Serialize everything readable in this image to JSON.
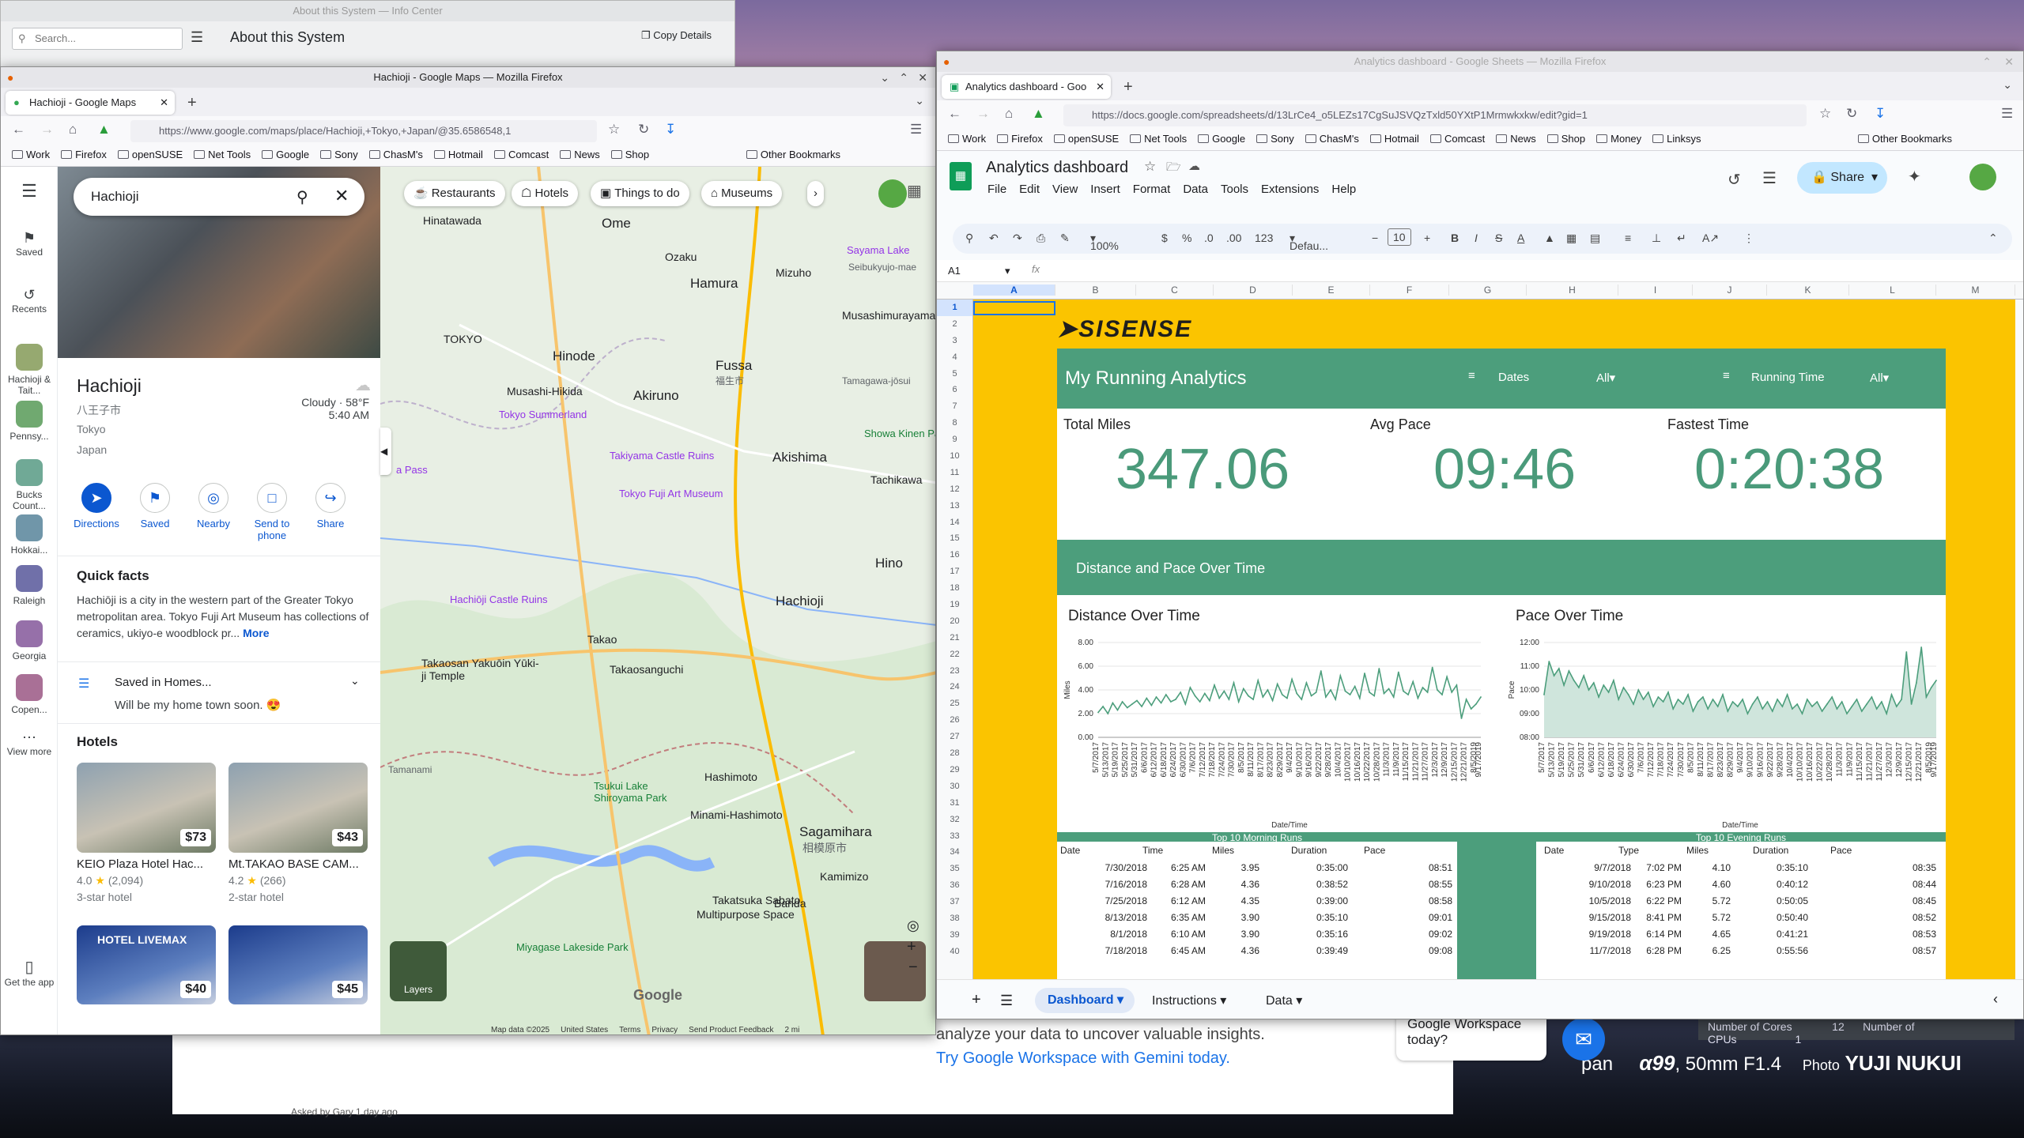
{
  "desktop": {
    "photo_credit_model": "α99",
    "photo_credit_lens": ", 50mm F1.4",
    "photo_credit_prefix": "Photo",
    "photo_credit_name": "YUJI NUKUI",
    "photo_credit_partial": "pan"
  },
  "info_center": {
    "title": "About this System — Info Center",
    "search_placeholder": "Search...",
    "heading": "About this System",
    "copy_button": "Copy Details"
  },
  "background_page": {
    "line1": "analyze your data to uncover valuable insights.",
    "line2": "Try Google Workspace with Gemini today.",
    "bubble": "Google Workspace today?",
    "sys_cores_label": "Number of Cores",
    "sys_cores_value": "12",
    "sys_cpus_label": "Number of CPUs",
    "sys_cpus_value": "1",
    "asked": "Asked by Gary 1 day ago"
  },
  "maps_window": {
    "title": "Hachioji - Google Maps — Mozilla Firefox",
    "tab_title": "Hachioji - Google Maps",
    "url": "https://www.google.com/maps/place/Hachioji,+Tokyo,+Japan/@35.6586548,1",
    "bookmarks": [
      "Work",
      "Firefox",
      "openSUSE",
      "Net Tools",
      "Google",
      "Sony",
      "ChasM's",
      "Hotmail",
      "Comcast",
      "News",
      "Shop"
    ],
    "other_bookmarks": "Other Bookmarks"
  },
  "maps": {
    "search_value": "Hachioji",
    "rail": [
      {
        "label": "Saved"
      },
      {
        "label": "Recents"
      },
      {
        "label": "Hachioji & Tait..."
      },
      {
        "label": "Pennsy..."
      },
      {
        "label": "Bucks Count..."
      },
      {
        "label": "Hokkai..."
      },
      {
        "label": "Raleigh"
      },
      {
        "label": "Georgia"
      },
      {
        "label": "Copen..."
      },
      {
        "label": "View more"
      }
    ],
    "get_app": "Get the app",
    "place": {
      "name": "Hachioji",
      "native": "八王子市",
      "region": "Tokyo",
      "country": "Japan",
      "weather": "Cloudy · 58°F",
      "time": "5:40 AM"
    },
    "actions": [
      "Directions",
      "Saved",
      "Nearby",
      "Send to phone",
      "Share"
    ],
    "quick_facts_title": "Quick facts",
    "quick_facts_text": "Hachiōji is a city in the western part of the Greater Tokyo metropolitan area. Tokyo Fuji Art Museum has collections of ceramics, ukiyo-e woodblock pr...",
    "more_link": "More",
    "saved_in": "Saved in Homes...",
    "saved_note": "Will be my home town soon. 😍",
    "hotels_title": "Hotels",
    "hotels": [
      {
        "price": "$73",
        "name": "KEIO Plaza Hotel Hac...",
        "rating": "4.0",
        "reviews": "(2,094)",
        "class": "3-star hotel"
      },
      {
        "price": "$43",
        "name": "Mt.TAKAO BASE CAM...",
        "rating": "4.2",
        "reviews": "(266)",
        "class": "2-star hotel"
      },
      {
        "price": "$40",
        "name": "HOTEL LIVEMAX"
      },
      {
        "price": "$45",
        "name": ""
      }
    ],
    "chips": [
      "Restaurants",
      "Hotels",
      "Things to do",
      "Museums"
    ],
    "labels": {
      "ome": "Ome",
      "tokyo": "TOKYO",
      "hinode": "Hinode",
      "hamura": "Hamura",
      "fussa": "Fussa",
      "fussa_jp": "福生市",
      "mizuho": "Mizuho",
      "musashimurayama": "Musashimurayama",
      "akiruno": "Akiruno",
      "musashi_hikida": "Musashi-Hikida",
      "akishima": "Akishima",
      "hino": "Hino",
      "hachioji": "Hachioji",
      "takao": "Takao",
      "takaosanguchi": "Takaosanguchi",
      "hashimoto": "Hashimoto",
      "minami_hashimoto": "Minami-Hashimoto",
      "sagamihara": "Sagamihara",
      "sagamihara_jp": "相模原市",
      "kamimizo": "Kamimizo",
      "tachikawa": "Tachikawa",
      "banda": "Banda",
      "hinatawada": "Hinatawada",
      "ozaku": "Ozaku",
      "tamagawa_josui": "Tamagawa-jōsui",
      "sayama_lake": "Sayama Lake",
      "seibukyujo": "Seibukyujo-mae",
      "tokyo_summerland": "Tokyo Summerland",
      "takiyama": "Takiyama Castle Ruins",
      "fuji_museum": "Tokyo Fuji Art Museum",
      "castle_ruins": "Hachiōji Castle Ruins",
      "takaosan_yakuoin": "Takaosan Yakuōin Yūki-ji Temple",
      "tsukui": "Tsukui Lake Shiroyama Park",
      "miyagase": "Miyagase Lakeside Park",
      "showa": "Showa Kinen Park",
      "takatsuka": "Multipurpose Space",
      "takatsuka_title": "Takatsuka Sabato",
      "tamanami": "Tamanami",
      "pass": "a Pass"
    },
    "layers": "Layers",
    "footer": [
      "Map data ©2025",
      "United States",
      "Terms",
      "Privacy",
      "Send Product Feedback",
      "2 mi"
    ]
  },
  "sheets_window": {
    "title": "Analytics dashboard - Google Sheets — Mozilla Firefox",
    "tab_title": "Analytics dashboard - Goo",
    "url": "https://docs.google.com/spreadsheets/d/13LrCe4_o5LEZs17CgSuJSVQzTxld50YXtP1Mrmwkxkw/edit?gid=1",
    "bookmarks": [
      "Work",
      "Firefox",
      "openSUSE",
      "Net Tools",
      "Google",
      "Sony",
      "ChasM's",
      "Hotmail",
      "Comcast",
      "News",
      "Shop",
      "Money",
      "Linksys"
    ],
    "other_bookmarks": "Other Bookmarks"
  },
  "sheets": {
    "doc_title": "Analytics dashboard",
    "menu": [
      "File",
      "Edit",
      "View",
      "Insert",
      "Format",
      "Data",
      "Tools",
      "Extensions",
      "Help"
    ],
    "share": "Share",
    "zoom": "100%",
    "font": "Defau...",
    "font_size": "10",
    "cell_ref": "A1",
    "columns": [
      "A",
      "B",
      "C",
      "D",
      "E",
      "F",
      "G",
      "H",
      "I",
      "J",
      "K",
      "L",
      "M"
    ],
    "tabs": [
      "Dashboard",
      "Instructions",
      "Data"
    ]
  },
  "dashboard": {
    "logo": "SISENSE",
    "title": "My Running Analytics",
    "filter1_label": "Dates",
    "filter1_value": "All",
    "filter2_label": "Running Time",
    "filter2_value": "All",
    "kpis": [
      {
        "label": "Total Miles",
        "value": "347.06"
      },
      {
        "label": "Avg Pace",
        "value": "09:46"
      },
      {
        "label": "Fastest Time",
        "value": "0:20:38"
      }
    ],
    "section_title": "Distance and Pace Over Time",
    "morning_title": "Top 10 Morning Runs",
    "morning_headers": [
      "Date",
      "Time",
      "Miles",
      "Duration",
      "Pace"
    ],
    "morning_rows": [
      [
        "7/30/2018",
        "6:25 AM",
        "3.95",
        "0:35:00",
        "08:51"
      ],
      [
        "7/16/2018",
        "6:28 AM",
        "4.36",
        "0:38:52",
        "08:55"
      ],
      [
        "7/25/2018",
        "6:12 AM",
        "4.35",
        "0:39:00",
        "08:58"
      ],
      [
        "8/13/2018",
        "6:35 AM",
        "3.90",
        "0:35:10",
        "09:01"
      ],
      [
        "8/1/2018",
        "6:10 AM",
        "3.90",
        "0:35:16",
        "09:02"
      ],
      [
        "7/18/2018",
        "6:45 AM",
        "4.36",
        "0:39:49",
        "09:08"
      ]
    ],
    "evening_title": "Top 10 Evening Runs",
    "evening_headers": [
      "Date",
      "Type",
      "Miles",
      "Duration",
      "Pace"
    ],
    "evening_rows": [
      [
        "9/7/2018",
        "7:02 PM",
        "4.10",
        "0:35:10",
        "08:35"
      ],
      [
        "9/10/2018",
        "6:23 PM",
        "4.60",
        "0:40:12",
        "08:44"
      ],
      [
        "10/5/2018",
        "6:22 PM",
        "5.72",
        "0:50:05",
        "08:45"
      ],
      [
        "9/15/2018",
        "8:41 PM",
        "5.72",
        "0:50:40",
        "08:52"
      ],
      [
        "9/19/2018",
        "6:14 PM",
        "4.65",
        "0:41:21",
        "08:53"
      ],
      [
        "11/7/2018",
        "6:28 PM",
        "6.25",
        "0:55:56",
        "08:57"
      ]
    ]
  },
  "chart_data": [
    {
      "type": "line",
      "title": "Distance Over Time",
      "xlabel": "Date/Time",
      "ylabel": "Miles",
      "ylim": [
        0,
        8
      ],
      "yticks": [
        "0.00",
        "2.00",
        "4.00",
        "6.00",
        "8.00"
      ],
      "x": [
        "5/7/2017",
        "5/10/2017",
        "5/13/2017",
        "5/16/2017",
        "5/19/2017",
        "5/22/2017",
        "5/25/2017",
        "5/28/2017",
        "5/31/2017",
        "6/3/2017",
        "6/6/2017",
        "6/9/2017",
        "6/12/2017",
        "6/15/2017",
        "6/18/2017",
        "6/21/2017",
        "6/24/2017",
        "6/27/2017",
        "6/30/2017",
        "7/3/2017",
        "7/6/2017",
        "7/9/2017",
        "7/12/2017",
        "7/15/2017",
        "7/18/2017",
        "7/21/2017",
        "7/24/2017",
        "7/27/2017",
        "7/30/2017",
        "8/2/2017",
        "8/5/2017",
        "8/8/2017",
        "8/11/2017",
        "8/14/2017",
        "8/17/2017",
        "8/20/2017",
        "8/23/2017",
        "8/26/2017",
        "8/29/2017",
        "9/1/2017",
        "9/4/2017",
        "9/7/2017",
        "9/10/2017",
        "9/13/2017",
        "9/16/2017",
        "9/19/2017",
        "9/22/2017",
        "9/25/2017",
        "9/28/2017",
        "10/1/2017",
        "10/4/2017",
        "10/7/2017",
        "10/10/2017",
        "10/13/2017",
        "10/16/2017",
        "10/19/2017",
        "10/22/2017",
        "10/25/2017",
        "10/28/2017",
        "10/31/2017",
        "11/3/2017",
        "11/6/2017",
        "11/9/2017",
        "11/12/2017",
        "11/15/2017",
        "11/18/2017",
        "11/21/2017",
        "11/24/2017",
        "11/27/2017",
        "11/30/2017",
        "12/3/2017",
        "12/6/2017",
        "12/9/2017",
        "12/12/2017",
        "12/15/2017",
        "12/18/2017",
        "12/21/2017",
        "4/18/2019",
        "8/5/2019",
        "9/17/2019"
      ],
      "series": [
        {
          "values": [
            2.1,
            2.6,
            2.0,
            2.9,
            2.3,
            3.0,
            2.5,
            2.8,
            3.1,
            2.6,
            3.3,
            2.7,
            3.4,
            2.9,
            3.6,
            3.0,
            3.2,
            3.8,
            2.8,
            4.2,
            3.5,
            3.0,
            3.7,
            3.1,
            4.4,
            3.3,
            3.9,
            3.2,
            4.6,
            3.0,
            4.1,
            3.5,
            3.2,
            4.8,
            3.4,
            4.0,
            3.1,
            4.5,
            3.6,
            3.3,
            4.9,
            3.7,
            3.2,
            4.6,
            3.5,
            3.8,
            5.6,
            3.4,
            4.0,
            3.2,
            5.2,
            3.9,
            3.6,
            4.3,
            3.3,
            5.4,
            3.8,
            3.5,
            5.8,
            3.7,
            4.1,
            3.4,
            5.5,
            3.9,
            3.6,
            4.7,
            3.3,
            4.2,
            3.8,
            5.9,
            4.0,
            3.6,
            5.1,
            3.8,
            4.4,
            1.6,
            3.2,
            2.4,
            2.8,
            3.4
          ]
        }
      ]
    },
    {
      "type": "area",
      "title": "Pace Over Time",
      "xlabel": "Date/Time",
      "ylabel": "Pace",
      "ylim": [
        "08:00",
        "12:00"
      ],
      "yticks": [
        "08:00",
        "09:00",
        "10:00",
        "11:00",
        "12:00"
      ],
      "x": [
        "5/7/2017",
        "5/10/2017",
        "5/13/2017",
        "5/16/2017",
        "5/19/2017",
        "5/22/2017",
        "5/25/2017",
        "5/28/2017",
        "5/31/2017",
        "6/3/2017",
        "6/6/2017",
        "6/9/2017",
        "6/12/2017",
        "6/15/2017",
        "6/18/2017",
        "6/21/2017",
        "6/24/2017",
        "6/27/2017",
        "6/30/2017",
        "7/3/2017",
        "7/6/2017",
        "7/9/2017",
        "7/12/2017",
        "7/15/2017",
        "7/18/2017",
        "7/21/2017",
        "7/24/2017",
        "7/27/2017",
        "7/30/2017",
        "8/2/2017",
        "8/5/2017",
        "8/8/2017",
        "8/11/2017",
        "8/14/2017",
        "8/17/2017",
        "8/20/2017",
        "8/23/2017",
        "8/26/2017",
        "8/29/2017",
        "9/1/2017",
        "9/4/2017",
        "9/7/2017",
        "9/10/2017",
        "9/13/2017",
        "9/16/2017",
        "9/19/2017",
        "9/22/2017",
        "9/25/2017",
        "9/28/2017",
        "10/1/2017",
        "10/4/2017",
        "10/7/2017",
        "10/10/2017",
        "10/13/2017",
        "10/16/2017",
        "10/19/2017",
        "10/22/2017",
        "10/25/2017",
        "10/28/2017",
        "10/31/2017",
        "11/3/2017",
        "11/6/2017",
        "11/9/2017",
        "11/12/2017",
        "11/15/2017",
        "11/18/2017",
        "11/21/2017",
        "11/24/2017",
        "11/27/2017",
        "11/30/2017",
        "12/3/2017",
        "12/6/2017",
        "12/9/2017",
        "12/12/2017",
        "12/15/2017",
        "12/18/2017",
        "12/21/2017",
        "4/18/2019",
        "8/5/2019",
        "9/17/2019"
      ],
      "series": [
        {
          "values": [
            9.8,
            11.2,
            10.6,
            10.9,
            10.2,
            10.8,
            10.4,
            10.1,
            10.6,
            10.0,
            10.3,
            9.7,
            10.2,
            9.9,
            10.4,
            9.6,
            10.1,
            9.8,
            9.4,
            10.0,
            9.6,
            9.9,
            9.3,
            9.7,
            9.5,
            9.9,
            9.2,
            9.6,
            9.4,
            9.8,
            9.1,
            9.5,
            9.7,
            9.2,
            9.6,
            9.3,
            9.8,
            9.1,
            9.5,
            9.3,
            9.6,
            9.0,
            9.4,
            9.7,
            9.2,
            9.5,
            9.1,
            9.6,
            9.3,
            9.8,
            9.2,
            9.4,
            9.0,
            9.6,
            9.3,
            9.5,
            9.1,
            9.4,
            9.7,
            9.2,
            9.5,
            9.0,
            9.3,
            9.6,
            9.1,
            9.4,
            9.7,
            9.2,
            9.5,
            9.0,
            9.8,
            9.3,
            9.6,
            11.6,
            9.4,
            10.3,
            11.8,
            9.7,
            10.1,
            10.4
          ]
        }
      ]
    }
  ]
}
